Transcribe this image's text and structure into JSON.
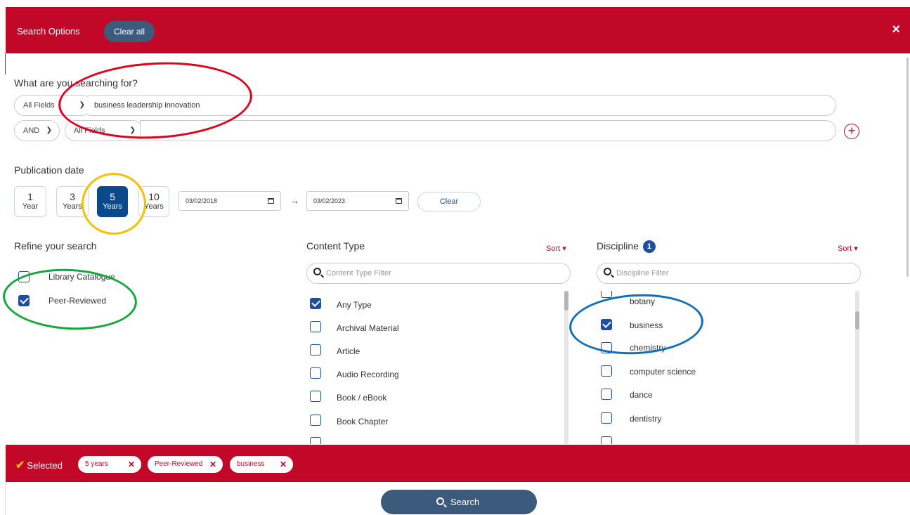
{
  "header": {
    "title": "Search Options",
    "clear_all": "Clear all",
    "close": "×"
  },
  "search": {
    "heading": "What are you searching for?",
    "row1": {
      "field": "All Fields",
      "value": "business leadership innovation"
    },
    "row2": {
      "operator": "AND",
      "field": "All Fields",
      "value": ""
    },
    "add_row": "+"
  },
  "date": {
    "heading": "Publication date",
    "buttons": [
      {
        "num": "1",
        "unit": "Year"
      },
      {
        "num": "3",
        "unit": "Years"
      },
      {
        "num": "5",
        "unit": "Years"
      },
      {
        "num": "10",
        "unit": "Years"
      }
    ],
    "selected_index": 2,
    "from": "03/02/2018",
    "to": "03/02/2023",
    "arrow": "→",
    "clear": "Clear"
  },
  "refine": {
    "heading": "Refine your search",
    "items": [
      {
        "label": "Library Catalogue",
        "checked": false
      },
      {
        "label": "Peer-Reviewed",
        "checked": true
      }
    ]
  },
  "content_type": {
    "heading": "Content Type",
    "sort": "Sort ▾",
    "filter_placeholder": "Content Type Filter",
    "items": [
      {
        "label": "Any Type",
        "checked": true
      },
      {
        "label": "Archival Material",
        "checked": false
      },
      {
        "label": "Article",
        "checked": false
      },
      {
        "label": "Audio Recording",
        "checked": false
      },
      {
        "label": "Book / eBook",
        "checked": false
      },
      {
        "label": "Book Chapter",
        "checked": false
      }
    ]
  },
  "discipline": {
    "heading": "Discipline",
    "badge": "1",
    "sort": "Sort ▾",
    "filter_placeholder": "Discipline Filter",
    "items": [
      {
        "label": "botany",
        "checked": false
      },
      {
        "label": "business",
        "checked": true
      },
      {
        "label": "chemistry",
        "checked": false
      },
      {
        "label": "computer science",
        "checked": false
      },
      {
        "label": "dance",
        "checked": false
      },
      {
        "label": "dentistry",
        "checked": false
      }
    ]
  },
  "selected": {
    "label": "Selected",
    "chips": [
      "5 years",
      "Peer-Reviewed",
      "business"
    ]
  },
  "search_button": "Search",
  "colors": {
    "brand_red": "#c10829",
    "navy_button": "#3c5a7c",
    "active_year": "#0a4a8c",
    "checkbox_blue": "#1f4e9e",
    "annotation_red": "#e3001b",
    "annotation_yellow": "#f5c000",
    "annotation_green": "#14a83c",
    "annotation_blue": "#0e6fc0"
  }
}
